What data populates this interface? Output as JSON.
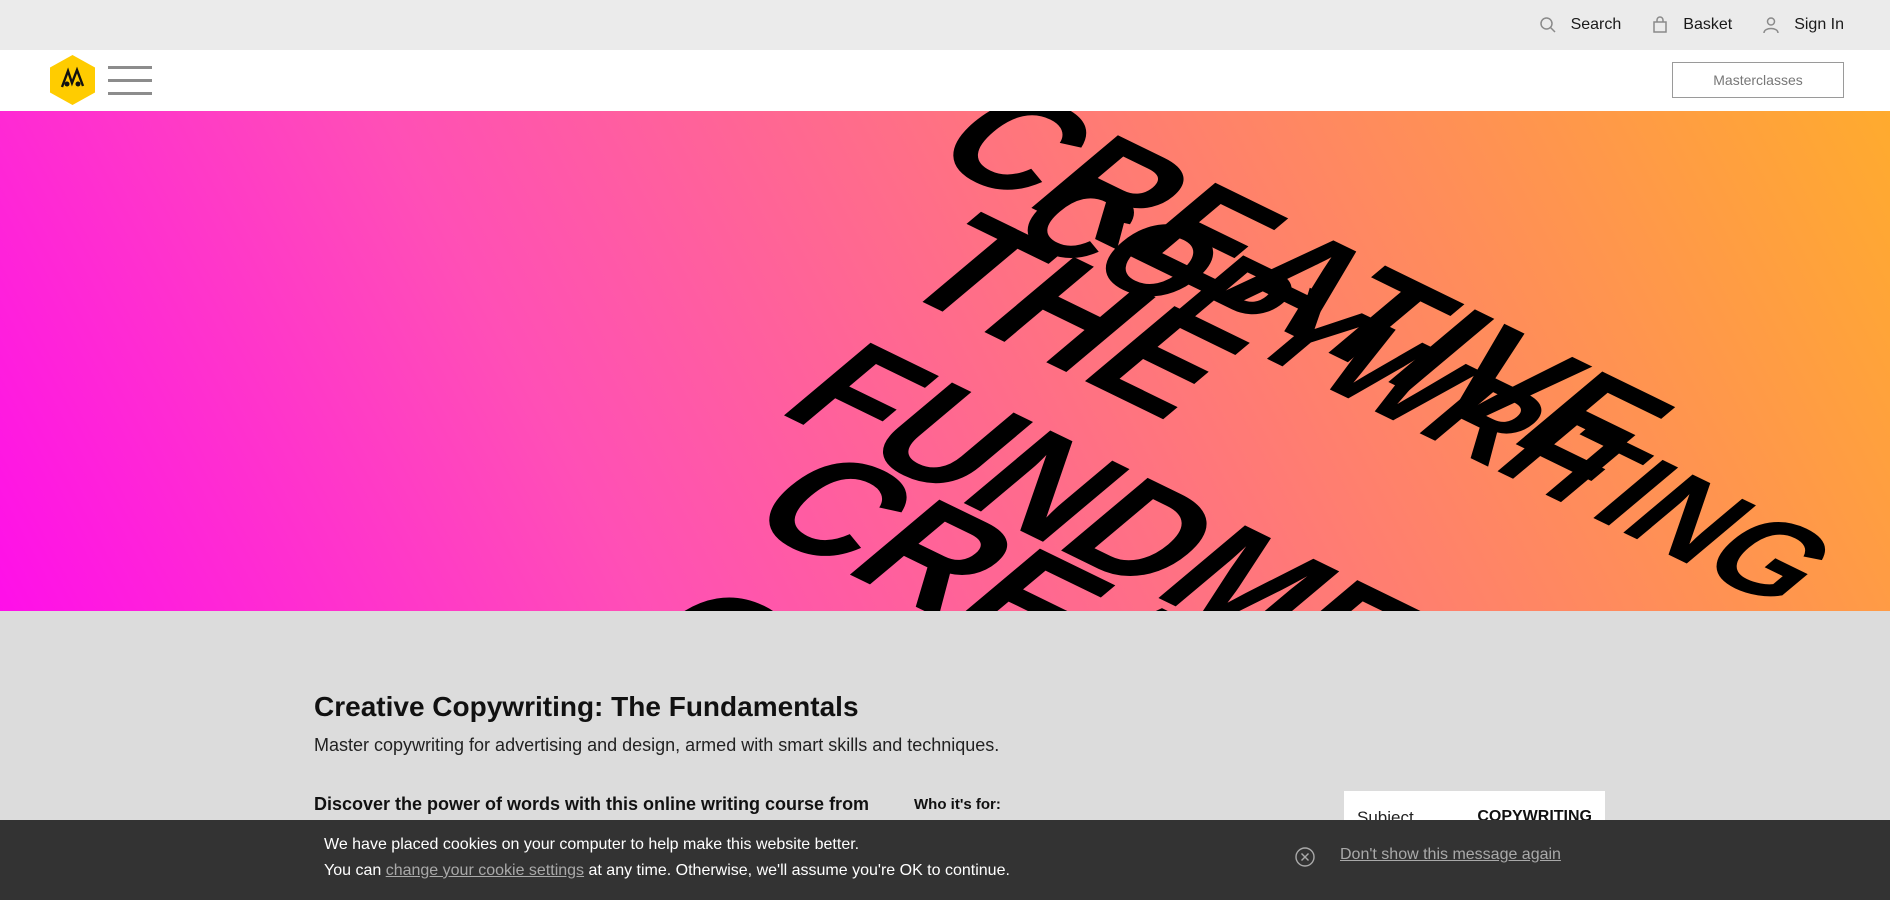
{
  "topnav": {
    "search_label": "Search",
    "basket_label": "Basket",
    "signin_label": "Sign In"
  },
  "header": {
    "logo_icon": "dandad-pencil-logo",
    "menu_icon": "hamburger-menu-icon",
    "cta_label": "Masterclasses"
  },
  "hero": {
    "lines": [
      "CREATIVE",
      "COPYWRITING",
      "THE",
      "FUNDMENTALS",
      "CREATIVE",
      "CO"
    ],
    "colors": {
      "start": "#ff0fe9",
      "mid": "#ff7e70",
      "end": "#ffab2e"
    }
  },
  "course": {
    "title": "Creative Copywriting: The Fundamentals",
    "subtitle": "Master copywriting for advertising and design, armed with smart skills and techniques.",
    "intro": "Discover the power of words with this online writing course from",
    "who_label": "Who it's for:",
    "meta": {
      "key": "Subject",
      "value": "COPYWRITING"
    }
  },
  "cookie": {
    "line1": "We have placed cookies on your computer to help make this website better.",
    "line2_prefix": "You can",
    "line2_link": "change your cookie settings",
    "line2_suffix": "at any time. Otherwise, we'll assume you're OK to continue.",
    "dismiss_label": "Don't show this message again"
  },
  "colors": {
    "logo_yellow": "#ffcc00",
    "cookie_bg": "#333333",
    "content_bg": "#dcdcdc"
  }
}
